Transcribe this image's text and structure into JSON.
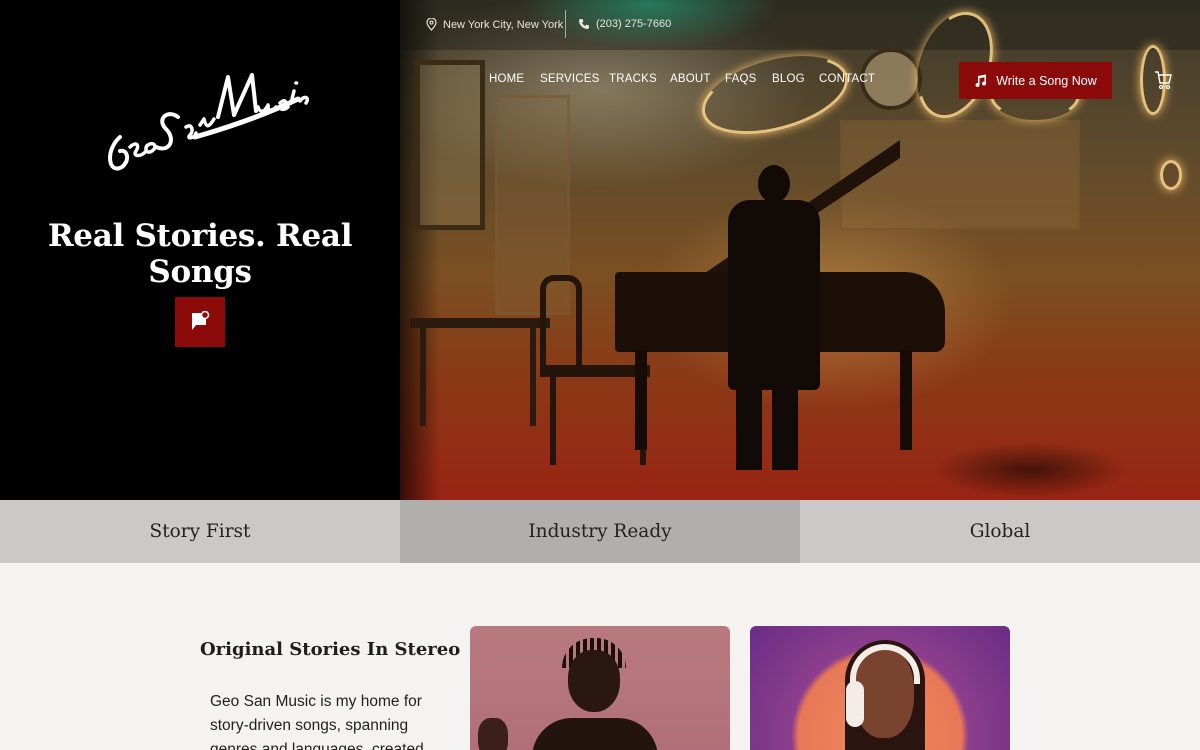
{
  "brand": {
    "logo_text": "Geo San Music"
  },
  "topbar": {
    "location": "New York City, New York",
    "phone": "(203) 275-7660"
  },
  "nav": {
    "items": [
      "HOME",
      "SERVICES",
      "TRACKS",
      "ABOUT",
      "FAQS",
      "BLOG",
      "CONTACT"
    ],
    "cta_label": "Write a Song Now"
  },
  "hero": {
    "title": "Real Stories. Real Songs"
  },
  "features": [
    "Story First",
    "Industry Ready",
    "Global"
  ],
  "section": {
    "heading": "Original Stories In Stereo",
    "body": "Geo San Music is my home for story-driven songs, spanning genres and languages, created"
  },
  "icons": {
    "location": "map-pin-icon",
    "phone": "phone-icon",
    "cta": "music-note-icon",
    "cart": "cart-icon",
    "chat": "chat-flag-icon"
  },
  "colors": {
    "accent": "#8b0b0b",
    "hero_left": "#000000",
    "feature_bg": "#cbc9c7",
    "feature_active_bg": "#b1afad",
    "page_bg": "#f4f3f1"
  }
}
